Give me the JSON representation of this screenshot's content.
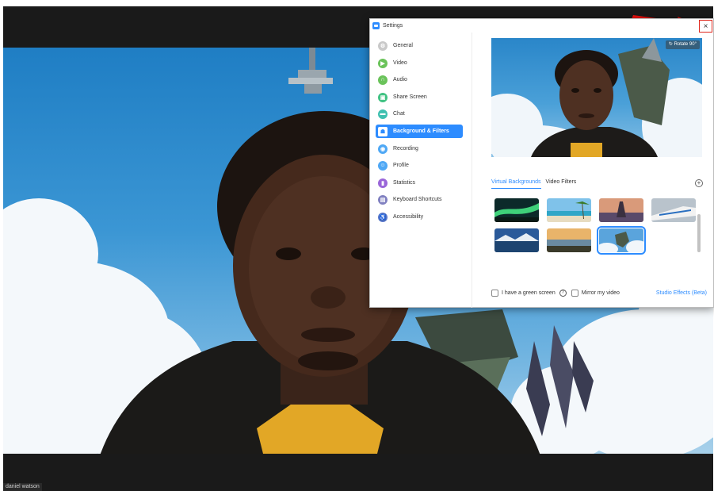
{
  "video": {
    "participant_name": "daniel watson"
  },
  "settings": {
    "title": "Settings",
    "close_label": "×",
    "nav": [
      {
        "label": "General",
        "icon": "gear-icon",
        "color": "#c9c9c9",
        "glyph": "⚙"
      },
      {
        "label": "Video",
        "icon": "video-icon",
        "color": "#6ac35a",
        "glyph": "▶"
      },
      {
        "label": "Audio",
        "icon": "headphones-icon",
        "color": "#6ac35a",
        "glyph": "∩"
      },
      {
        "label": "Share Screen",
        "icon": "share-screen-icon",
        "color": "#41c283",
        "glyph": "▣"
      },
      {
        "label": "Chat",
        "icon": "chat-icon",
        "color": "#3fc0b0",
        "glyph": "▬"
      },
      {
        "label": "Background & Filters",
        "icon": "person-icon",
        "color": "#2d8cff",
        "glyph": "☗"
      },
      {
        "label": "Recording",
        "icon": "recording-icon",
        "color": "#4fa8f5",
        "glyph": "◉"
      },
      {
        "label": "Profile",
        "icon": "profile-icon",
        "color": "#4fa8f5",
        "glyph": "☺"
      },
      {
        "label": "Statistics",
        "icon": "statistics-icon",
        "color": "#9a66d9",
        "glyph": "▮"
      },
      {
        "label": "Keyboard Shortcuts",
        "icon": "keyboard-icon",
        "color": "#8080c0",
        "glyph": "▤"
      },
      {
        "label": "Accessibility",
        "icon": "accessibility-icon",
        "color": "#5b78c9",
        "glyph": "♿"
      }
    ],
    "active_nav": "Background & Filters",
    "rotate_label": "↻ Rotate 90°",
    "tabs": [
      "Virtual Backgrounds",
      "Video Filters"
    ],
    "active_tab": "Virtual Backgrounds",
    "add_label": "+",
    "green_screen_label": "I have a green screen",
    "mirror_label": "Mirror my video",
    "studio_effects_label": "Studio Effects (Beta)",
    "accent_color": "#2d8cff",
    "highlight_color": "#e0271c"
  }
}
